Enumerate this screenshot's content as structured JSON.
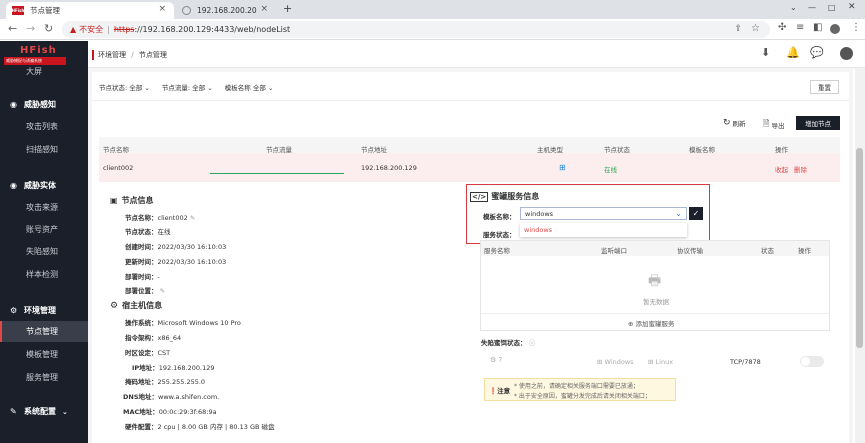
{
  "browser": {
    "tabs": [
      {
        "label": "节点管理",
        "favicon_text": "HFish"
      },
      {
        "label": "192.168.200.20"
      }
    ],
    "new_tab": "+",
    "url_warning": "不安全",
    "url_scheme": "https",
    "url_rest": "://192.168.200.129:4433/web/nodeList",
    "url_separator": "|"
  },
  "sidebar": {
    "logo_title": "HFish",
    "logo_subtitle": "威胁捕捉与诱骗系统",
    "partial_item": "大屏",
    "sections": [
      {
        "label": "威胁感知",
        "items": [
          "攻击列表",
          "扫描感知"
        ]
      },
      {
        "label": "威胁实体",
        "items": [
          "攻击来源",
          "账号资产",
          "失陷感知",
          "样本检测"
        ]
      },
      {
        "label": "环境管理",
        "items": [
          "节点管理",
          "模板管理",
          "服务管理"
        ]
      },
      {
        "label": "系统配置",
        "items": []
      }
    ]
  },
  "breadcrumb": {
    "root": "环境管理",
    "separator": "/",
    "current": "节点管理"
  },
  "filters": {
    "status_label": "节点状态:",
    "status_value": "全部",
    "traffic_label": "节点流量:",
    "traffic_value": "全部",
    "template_label": "模板名称",
    "template_value": "全部",
    "reset": "重置"
  },
  "actions": {
    "refresh": "刷新",
    "export": "导出",
    "add_node": "增加节点"
  },
  "table": {
    "headers": [
      "节点名称",
      "节点流量",
      "节点地址",
      "主机类型",
      "节点状态",
      "模板名称",
      "操作"
    ],
    "row": {
      "name": "client002",
      "address": "192.168.200.129",
      "status": "在线",
      "op_collapse": "收起",
      "op_delete": "删除"
    }
  },
  "node_info": {
    "title": "节点信息",
    "fields": [
      {
        "label": "节点名称：",
        "value": "client002"
      },
      {
        "label": "节点状态：",
        "value": "在线"
      },
      {
        "label": "创建时间：",
        "value": "2022/03/30 16:10:03"
      },
      {
        "label": "更新时间：",
        "value": "2022/03/30 16:10:03"
      },
      {
        "label": "部署时间：",
        "value": "-"
      },
      {
        "label": "部署位置：",
        "value": ""
      }
    ]
  },
  "host_info": {
    "title": "宿主机信息",
    "fields": [
      {
        "label": "操作系统：",
        "value": "Microsoft Windows 10 Pro"
      },
      {
        "label": "指令架构：",
        "value": "x86_64"
      },
      {
        "label": "时区设定：",
        "value": "CST"
      },
      {
        "label": "IP地址：",
        "value": "192.168.200.129"
      },
      {
        "label": "掩码地址：",
        "value": "255.255.255.0"
      },
      {
        "label": "DNS地址：",
        "value": "www.a.shifen.com."
      },
      {
        "label": "MAC地址：",
        "value": "00:0c:29:3f:68:9a"
      },
      {
        "label": "硬件配置：",
        "value": "2 cpu | 8.00 GB 内存 | 80.13 GB 磁盘"
      }
    ]
  },
  "honeypot": {
    "title": "蜜罐服务信息",
    "template_label": "模板名称：",
    "template_value": "windows",
    "dropdown_option": "windows",
    "status_label": "服务状态：",
    "service_headers": [
      "服务名称",
      "监听端口",
      "协议传输",
      "状态",
      "操作"
    ],
    "empty_text": "暂无数据",
    "add_service": "添加蜜罐服务",
    "trap_label": "失陷蜜饵状态：",
    "trap_os1": "Windows",
    "trap_os2": "Linux",
    "trap_port": "TCP/7878",
    "notice_title": "注意",
    "notice_line1": "* 使用之前，请确定相关服务端口需要已放通；",
    "notice_line2": "* 出于安全原因，蜜罐分发完成后请关闭相关端口；"
  },
  "colors": {
    "accent": "#c9151e",
    "sidebar_bg": "#1b1f2a",
    "online": "#2aa55a",
    "link_red": "#e04848",
    "highlight_box": "#d9383e"
  }
}
